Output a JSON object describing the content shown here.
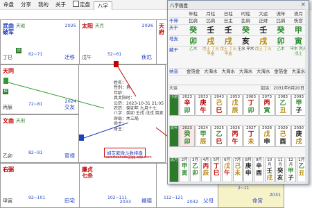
{
  "menu": {
    "items": [
      "命盘",
      "分享",
      "我的",
      "关于"
    ],
    "checkbox_label": "定盘",
    "tab": "八字"
  },
  "chart": {
    "cells": [
      {
        "id": "si",
        "main": "武曲",
        "main2": "破军",
        "sub": "天钺",
        "badge": "忌",
        "gz": "丁巳",
        "range": "62~71",
        "pal": "迁移",
        "age": "2025",
        "pal_age": "大财"
      },
      {
        "id": "wu",
        "main": "太阳",
        "sub": "天月",
        "gz": "戊午",
        "range": "52~61",
        "pal": "疾厄",
        "age": "2026",
        "pal_age": "大子"
      },
      {
        "id": "wei",
        "main": "天府",
        "sub": "",
        "gz": "丁未",
        "range": "",
        "pal": "",
        "age": "",
        "pal_age": ""
      },
      {
        "id": "chen",
        "main": "天同",
        "sub": "",
        "gz": "丙辰",
        "range": "72~81",
        "pal": "交友",
        "age": "2024",
        "pal_age": "大疾"
      },
      {
        "id": "mao",
        "main": "文曲",
        "sub": "天刑",
        "gz": "乙卯",
        "range": "82~91",
        "pal": "官禄",
        "age": "",
        "pal_age": "大父"
      },
      {
        "id": "yin",
        "main": "右弼",
        "sub": "",
        "gz": "甲寅",
        "range": "92~101",
        "pal": "田宅",
        "age": "",
        "pal_age": "大官"
      },
      {
        "id": "chou",
        "main": "廉贞",
        "main2": "七杀",
        "sub": "",
        "gz": "",
        "range": "102~111",
        "pal": "福德",
        "age": "2033",
        "pal_age": "大田"
      },
      {
        "id": "zi",
        "main": "",
        "sub": "",
        "gz": "",
        "range": "112~121",
        "pal": "父母",
        "age": "2032",
        "pal_age": ""
      },
      {
        "id": "hai",
        "main": "",
        "sub": "",
        "gz": "",
        "range": "2~11",
        "pal": "命宫",
        "age": "2031",
        "pal_age": ""
      }
    ],
    "info_lines": [
      "姓名：",
      "性别：男",
      "年龄：",
      "真太阳时：",
      "公历：2023-10-31 21:05",
      "农历：癸卯年 九月十七",
      "八字：癸卯 壬戌 戊戌 癸亥",
      "命局：木三局",
      "命主：",
      "身主："
    ],
    "stamp_label": "胡芷紫微斗数排盘",
    "stamp_url": "comrtechorb@gg.app.com"
  },
  "panel": {
    "title": "八字画盘",
    "headers": [
      "年柱",
      "月柱",
      "日柱",
      "时柱",
      "大运",
      "流年",
      "流月"
    ],
    "row_ganshen": [
      "比肩",
      "比肩",
      "日主",
      "比肩",
      "正财",
      "比肩",
      "伤官"
    ],
    "stems": [
      "癸",
      "壬",
      "壬",
      "癸",
      "壬",
      "癸",
      "甲"
    ],
    "branches": [
      "卯",
      "戌",
      "戌",
      "亥",
      "戌",
      "卯",
      "寅"
    ],
    "row_labels": [
      "干神",
      "天干",
      "地支",
      "藏干",
      "纳音"
    ],
    "hidden": [
      "乙木",
      "戊土 丁火 辛金",
      "戊土 丁火 辛金",
      "壬水 甲木",
      "戊土 丁火",
      "乙木",
      "甲木 丙火 戊土"
    ],
    "nayin": [
      "金箔金",
      "大海水",
      "大海水",
      "大海水",
      "大海水",
      "金箔金",
      "大溪水"
    ],
    "footer_left": "大运",
    "footer_right": "起运：2031年6月20日",
    "decade_label": "小运",
    "decade_years": [
      "2023",
      "2033",
      "2043",
      "2053",
      "2063",
      "2073",
      "2083",
      "2093"
    ],
    "decade_stems": [
      "辛",
      "庚",
      "己",
      "戊",
      "丁",
      "丙",
      "乙",
      "甲"
    ],
    "decade_branches": [
      "卯",
      "午",
      "巳",
      "辰",
      "卯",
      "寅",
      "丑",
      "子"
    ],
    "year_label": "流年",
    "years": [
      "2023",
      "2024",
      "2025",
      "2026",
      "2027",
      "2028",
      "2029",
      "2030"
    ],
    "year_stems": [
      "癸",
      "甲",
      "乙",
      "丙",
      "丁",
      "戊",
      "己",
      "庚"
    ],
    "year_branches": [
      "卯",
      "辰",
      "巳",
      "午",
      "未",
      "申",
      "酉",
      "戌"
    ],
    "month_label": "流月",
    "months": [
      "2月",
      "3月",
      "4月",
      "5月",
      "6月",
      "7月",
      "8月",
      "9月",
      "10月",
      "11月",
      "12月",
      "1月"
    ],
    "month_stems": [
      "甲",
      "乙",
      "丙",
      "丁",
      "戊",
      "己",
      "庚",
      "辛",
      "壬",
      "癸",
      "甲",
      "乙"
    ],
    "month_branches": [
      "寅",
      "卯",
      "辰",
      "巳",
      "午",
      "未",
      "申",
      "酉",
      "戌",
      "亥",
      "子",
      "丑"
    ]
  }
}
